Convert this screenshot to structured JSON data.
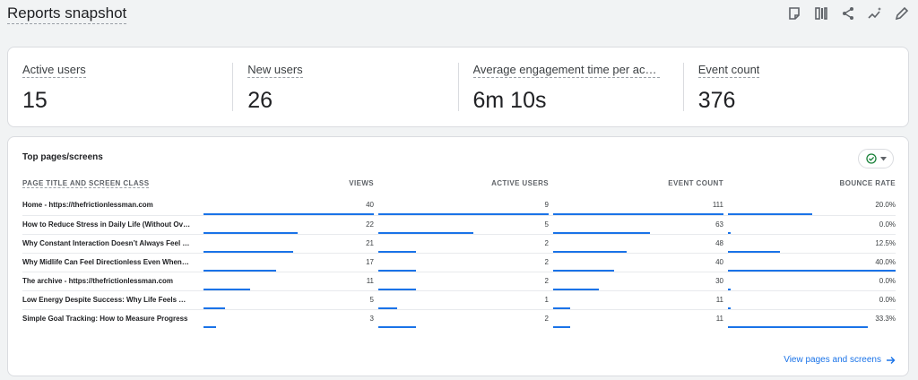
{
  "header": {
    "title": "Reports snapshot"
  },
  "metrics": [
    {
      "label": "Active users",
      "value": "15"
    },
    {
      "label": "New users",
      "value": "26"
    },
    {
      "label": "Average engagement time per active user",
      "value": "6m 10s"
    },
    {
      "label": "Event count",
      "value": "376"
    }
  ],
  "table": {
    "title": "Top pages/screens",
    "headers": {
      "page": "PAGE TITLE AND SCREEN CLASS",
      "views": "VIEWS",
      "users": "ACTIVE USERS",
      "events": "EVENT COUNT",
      "bounce": "BOUNCE RATE"
    },
    "rows": [
      {
        "page": "Home - https://thefrictionlessman.com",
        "views": 40,
        "users": 9,
        "events": 111,
        "bounce": "20.0%",
        "bounce_value": 20.0
      },
      {
        "page": "How to Reduce Stress in Daily Life (Without Overhauling Everything)",
        "views": 22,
        "users": 5,
        "events": 63,
        "bounce": "0.0%",
        "bounce_value": 0.0
      },
      {
        "page": "Why Constant Interaction Doesn’t Always Feel Like Connection",
        "views": 21,
        "users": 2,
        "events": 48,
        "bounce": "12.5%",
        "bounce_value": 12.5
      },
      {
        "page": "Why Midlife Can Feel Directionless Even When Things Are Fine",
        "views": 17,
        "users": 2,
        "events": 40,
        "bounce": "40.0%",
        "bounce_value": 40.0
      },
      {
        "page": "The archive - https://thefrictionlessman.com",
        "views": 11,
        "users": 2,
        "events": 30,
        "bounce": "0.0%",
        "bounce_value": 0.0
      },
      {
        "page": "Low Energy Despite Success: Why Life Feels Heavy",
        "views": 5,
        "users": 1,
        "events": 11,
        "bounce": "0.0%",
        "bounce_value": 0.0
      },
      {
        "page": "Simple Goal Tracking: How to Measure Progress",
        "views": 3,
        "users": 2,
        "events": 11,
        "bounce": "33.3%",
        "bounce_value": 33.3
      }
    ],
    "view_link": "View pages and screens"
  },
  "colors": {
    "accent": "#1a73e8",
    "compare_green": "#188038"
  }
}
